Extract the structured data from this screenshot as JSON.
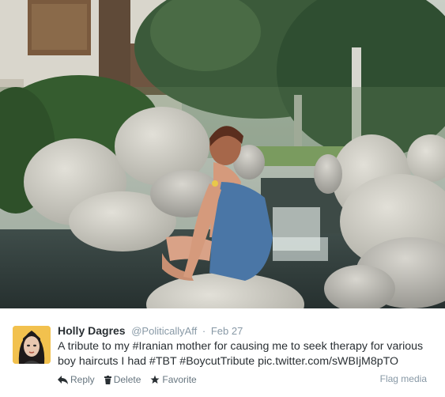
{
  "tweet": {
    "display_name": "Holly Dagres",
    "screen_name": "@PoliticallyAff",
    "separator": "·",
    "timestamp": "Feb 27",
    "text": "A tribute to my #Iranian mother for causing me to seek therapy for various boy haircuts I had #TBT #BoycutTribute pic.twitter.com/sWBIjM8pTO"
  },
  "actions": {
    "reply": "Reply",
    "delete": "Delete",
    "favorite": "Favorite",
    "flag_media": "Flag media"
  },
  "icons": {
    "reply": "reply-icon",
    "delete": "trash-icon",
    "favorite": "star-icon"
  },
  "colors": {
    "name": "#292f33",
    "meta": "#8899a6",
    "action": "#66757f"
  }
}
